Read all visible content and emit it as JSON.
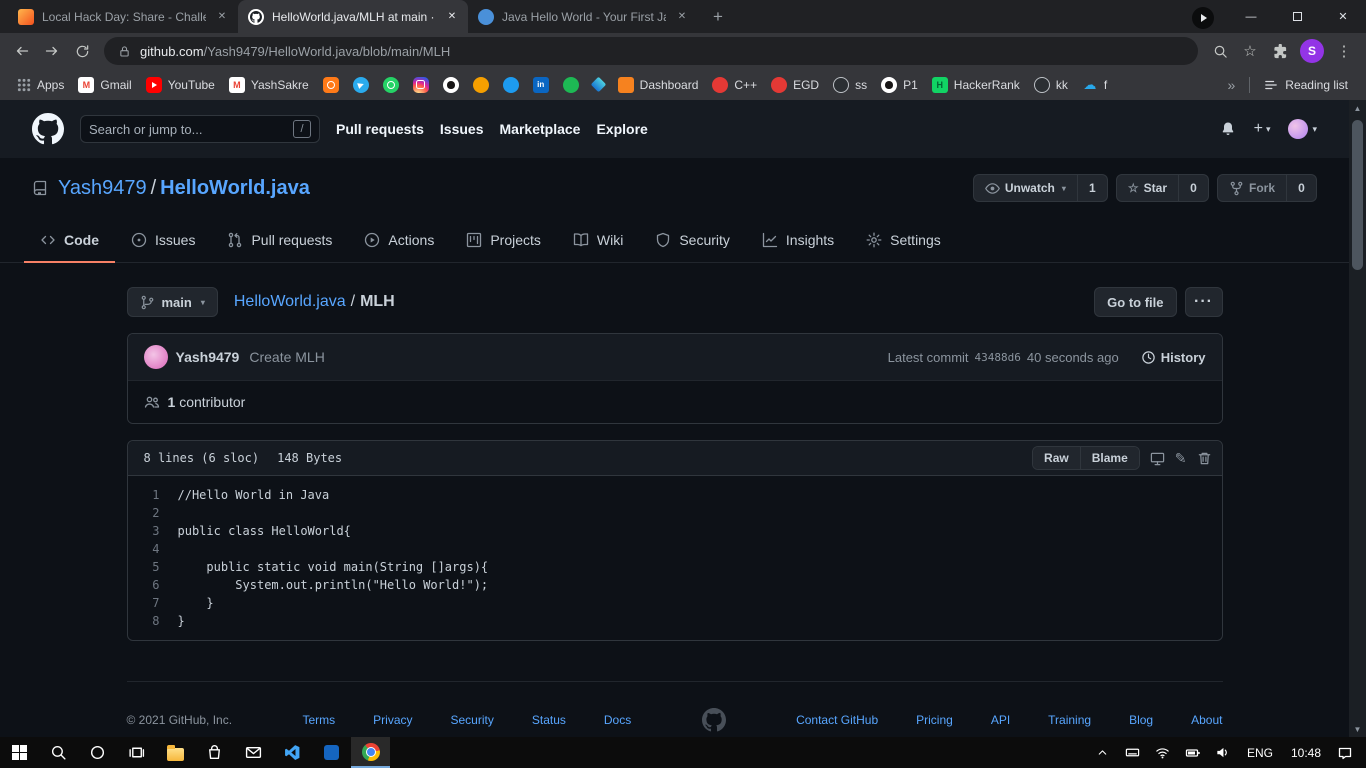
{
  "theme": {
    "link_blue": "#58a6ff",
    "active_tab_underline": "#f78166",
    "page_bg": "#0d1117",
    "panel_bg": "#161b22"
  },
  "browser": {
    "tabs": [
      {
        "title": "Local Hack Day: Share - Challeng",
        "active": false
      },
      {
        "title": "HelloWorld.java/MLH at main · Ya",
        "active": true
      },
      {
        "title": "Java Hello World - Your First Java",
        "active": false
      }
    ],
    "url_host": "github.com",
    "url_path": "/Yash9479/HelloWorld.java/blob/main/MLH",
    "profile_initial": "S",
    "bookmarks_bar": {
      "items": [
        {
          "label": "Apps",
          "icon": "i-apps"
        },
        {
          "label": "Gmail",
          "icon": "i-gmail"
        },
        {
          "label": "YouTube",
          "icon": "i-youtube"
        },
        {
          "label": "YashSakre",
          "icon": "i-gmail"
        },
        {
          "label": "",
          "icon": "i-camera"
        },
        {
          "label": "",
          "icon": "i-telegram"
        },
        {
          "label": "",
          "icon": "i-whatsapp"
        },
        {
          "label": "",
          "icon": "i-instagram"
        },
        {
          "label": "",
          "icon": "i-github"
        },
        {
          "label": "",
          "icon": "i-maple"
        },
        {
          "label": "",
          "icon": "i-twitter"
        },
        {
          "label": "",
          "icon": "i-linkedin"
        },
        {
          "label": "",
          "icon": "i-spotify"
        },
        {
          "label": "",
          "icon": "i-diamond"
        },
        {
          "label": "Dashboard",
          "icon": "i-dashboard"
        },
        {
          "label": "C++",
          "icon": "i-red"
        },
        {
          "label": "EGD",
          "icon": "i-red"
        },
        {
          "label": "ss",
          "icon": "i-globe"
        },
        {
          "label": "P1",
          "icon": "i-github"
        },
        {
          "label": "HackerRank",
          "icon": "i-hackerrank"
        },
        {
          "label": "kk",
          "icon": "i-globe"
        },
        {
          "label": "f",
          "icon": "i-cloud"
        }
      ],
      "reading_list": "Reading list"
    }
  },
  "github": {
    "header": {
      "search_placeholder": "Search or jump to...",
      "slash_hint": "/",
      "nav": [
        "Pull requests",
        "Issues",
        "Marketplace",
        "Explore"
      ]
    },
    "repo": {
      "owner": "Yash9479",
      "separator": "/",
      "name": "HelloWorld.java",
      "unwatch_label": "Unwatch",
      "unwatch_count": "1",
      "star_label": "Star",
      "star_count": "0",
      "fork_label": "Fork",
      "fork_count": "0",
      "tabs": [
        {
          "label": "Code"
        },
        {
          "label": "Issues"
        },
        {
          "label": "Pull requests"
        },
        {
          "label": "Actions"
        },
        {
          "label": "Projects"
        },
        {
          "label": "Wiki"
        },
        {
          "label": "Security"
        },
        {
          "label": "Insights"
        },
        {
          "label": "Settings"
        }
      ]
    },
    "file_nav": {
      "branch": "main",
      "breadcrumb_repo": "HelloWorld.java",
      "breadcrumb_sep": "/",
      "breadcrumb_file": "MLH",
      "go_to_file": "Go to file"
    },
    "commit": {
      "author": "Yash9479",
      "message": "Create MLH",
      "latest_label": "Latest commit",
      "sha": "43488d6",
      "time_ago": "40 seconds ago",
      "history": "History"
    },
    "contributors": {
      "count": "1",
      "label": "contributor"
    },
    "file": {
      "lines_info": "8 lines (6 sloc)",
      "size": "148 Bytes",
      "raw": "Raw",
      "blame": "Blame",
      "code": [
        "//Hello World in Java",
        "",
        "public class HelloWorld{",
        "",
        "    public static void main(String []args){",
        "        System.out.println(\"Hello World!\");",
        "    }",
        "}"
      ]
    },
    "footer": {
      "copyright": "© 2021 GitHub, Inc.",
      "links_left": [
        "Terms",
        "Privacy",
        "Security",
        "Status",
        "Docs"
      ],
      "links_right": [
        "Contact GitHub",
        "Pricing",
        "API",
        "Training",
        "Blog",
        "About"
      ]
    }
  },
  "taskbar": {
    "language": "ENG",
    "time": "10:48"
  }
}
